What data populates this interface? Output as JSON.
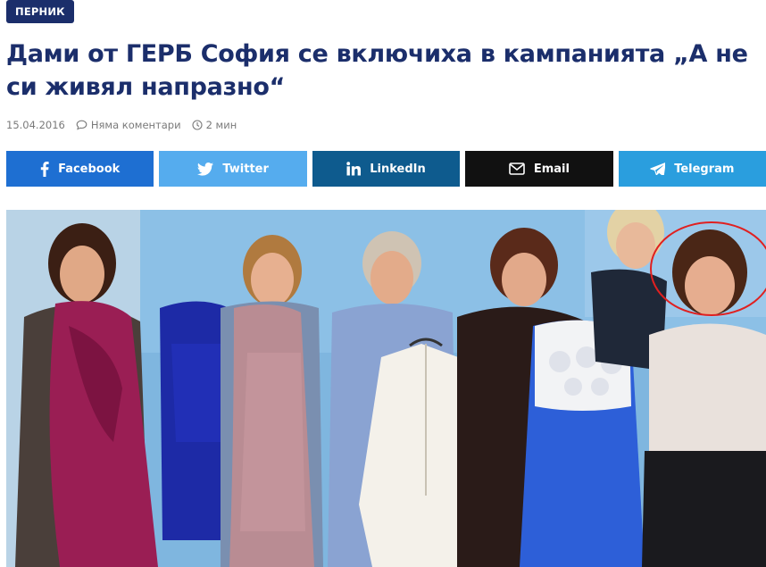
{
  "category": {
    "label": "ПЕРНИК"
  },
  "article": {
    "title": "Дами от ГЕРБ София се включиха в кампанията „А не си живял напразно“",
    "date": "15.04.2016",
    "comments": "Няма коментари",
    "read_time": "2 мин"
  },
  "share": {
    "facebook": "Facebook",
    "twitter": "Twitter",
    "linkedin": "LinkedIn",
    "email": "Email",
    "telegram": "Telegram"
  },
  "colors": {
    "brand_navy": "#1b2e6b",
    "facebook": "#1e6fd2",
    "twitter": "#55acee",
    "linkedin": "#0e5b8e",
    "email": "#111111",
    "telegram": "#2a9ede"
  },
  "icons": {
    "comment": "comment-icon",
    "clock": "clock-icon",
    "facebook": "facebook-icon",
    "twitter": "twitter-icon",
    "linkedin": "linkedin-icon",
    "email": "envelope-icon",
    "telegram": "telegram-icon"
  }
}
